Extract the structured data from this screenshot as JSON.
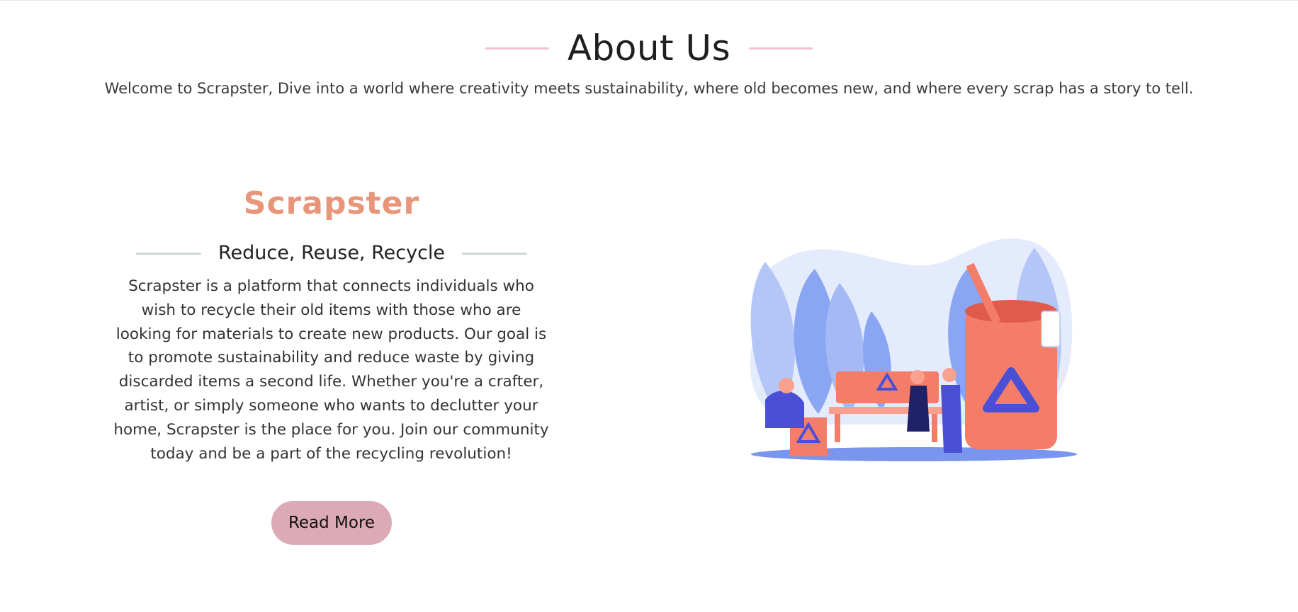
{
  "about": {
    "title": "About Us",
    "intro": "Welcome to Scrapster, Dive into a world where creativity meets sustainability, where old becomes new, and where every scrap has a story to tell."
  },
  "feature": {
    "brand": "Scrapster",
    "tagline": "Reduce, Reuse, Recycle",
    "description": "Scrapster is a platform that connects individuals who wish to recycle their old items with those who are looking for materials to create new products. Our goal is to promote sustainability and reduce waste by giving discarded items a second life. Whether you're a crafter, artist, or simply someone who wants to declutter your home, Scrapster is the place for you. Join our community today and be a part of the recycling revolution!",
    "button_label": "Read More"
  },
  "colors": {
    "accent_pink": "#efc2cf",
    "brand_orange": "#e8957a",
    "rule_mint": "#c8dbd5",
    "button_pink": "#dcaab7",
    "illus_blue": "#8aa6f3",
    "illus_coral": "#f47d6a",
    "illus_indigo": "#4b4fd6"
  },
  "illustration": {
    "icon": "recycling-illustration"
  }
}
